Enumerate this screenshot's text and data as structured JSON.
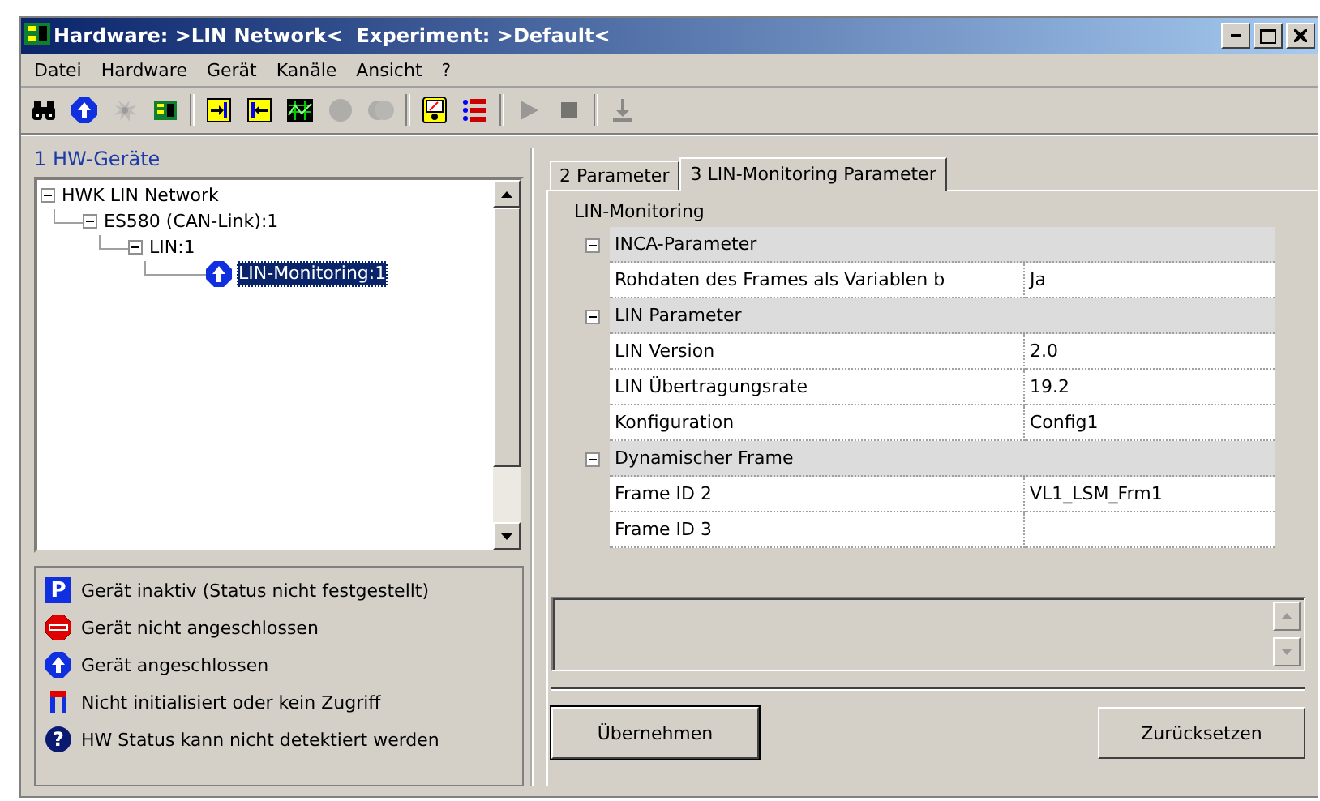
{
  "window": {
    "title": "Hardware: >LIN Network<  Experiment: >Default<"
  },
  "menu": [
    "Datei",
    "Hardware",
    "Gerät",
    "Kanäle",
    "Ansicht",
    "?"
  ],
  "toolbar": [
    {
      "kind": "binoculars",
      "disabled": false
    },
    {
      "kind": "connect",
      "disabled": false
    },
    {
      "kind": "burst",
      "disabled": true
    },
    {
      "kind": "board",
      "disabled": false
    },
    {
      "kind": "separator"
    },
    {
      "kind": "import",
      "disabled": false
    },
    {
      "kind": "export",
      "disabled": false
    },
    {
      "kind": "grid",
      "disabled": false
    },
    {
      "kind": "circle",
      "disabled": true
    },
    {
      "kind": "double-circle",
      "disabled": true
    },
    {
      "kind": "separator"
    },
    {
      "kind": "meter",
      "disabled": false
    },
    {
      "kind": "list",
      "disabled": false
    },
    {
      "kind": "separator"
    },
    {
      "kind": "play",
      "disabled": true
    },
    {
      "kind": "stop",
      "disabled": true
    },
    {
      "kind": "separator"
    },
    {
      "kind": "download",
      "disabled": true
    }
  ],
  "hw_panel": {
    "title": "1 HW-Geräte",
    "tree": [
      {
        "label": "HWK LIN Network",
        "expanded": true,
        "selected": false,
        "children": [
          {
            "label": "ES580 (CAN-Link):1",
            "expanded": true,
            "selected": false,
            "children": [
              {
                "label": "LIN:1",
                "expanded": true,
                "selected": false,
                "children": [
                  {
                    "label": "LIN-Monitoring:1",
                    "kind": "connected",
                    "selected": true
                  }
                ]
              }
            ]
          }
        ]
      }
    ]
  },
  "legend": [
    {
      "kind": "parking",
      "glyph": "P",
      "text": "Gerät inaktiv (Status nicht festgestellt)"
    },
    {
      "kind": "stop",
      "text": "Gerät nicht angeschlossen"
    },
    {
      "kind": "connected",
      "text": "Gerät angeschlossen"
    },
    {
      "kind": "blocked",
      "text": "Nicht initialisiert oder kein Zugriff"
    },
    {
      "kind": "unknown",
      "glyph": "?",
      "text": "HW Status kann nicht detektiert werden"
    }
  ],
  "tabs": [
    {
      "label": "2 Parameter",
      "selected": false
    },
    {
      "label": "3 LIN-Monitoring Parameter",
      "selected": true
    }
  ],
  "property_grid": {
    "title": "LIN-Monitoring",
    "sections": [
      {
        "name": "INCA-Parameter",
        "expanded": true,
        "rows": [
          {
            "name": "Rohdaten des Frames als Variablen b",
            "value": "Ja"
          }
        ]
      },
      {
        "name": "LIN Parameter",
        "expanded": true,
        "rows": [
          {
            "name": "LIN Version",
            "value": "2.0"
          },
          {
            "name": "LIN Übertragungsrate",
            "value": "19.2"
          },
          {
            "name": "Konfiguration",
            "value": "Config1"
          }
        ]
      },
      {
        "name": "Dynamischer Frame",
        "expanded": true,
        "rows": [
          {
            "name": "Frame ID 2",
            "value": "VL1_LSM_Frm1"
          },
          {
            "name": "Frame ID 3"
          }
        ]
      }
    ]
  },
  "buttons": [
    "Übernehmen",
    "Zurücksetzen"
  ]
}
